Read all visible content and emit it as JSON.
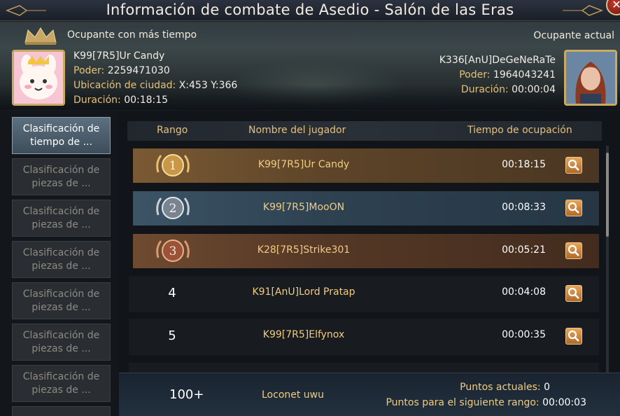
{
  "window": {
    "title": "Información de combate de Asedio - Salón de las Eras",
    "close_icon": "close-icon"
  },
  "header": {
    "longest_label": "Ocupante con más tiempo",
    "current_label": "Ocupante actual",
    "longest": {
      "name": "K99[7R5]Ur Candy",
      "power_label": "Poder:",
      "power": "2259471030",
      "location_label": "Ubicación de ciudad:",
      "location": "X:453 Y:366",
      "duration_label": "Duración:",
      "duration": "00:18:15"
    },
    "current": {
      "name": "K336[AnU]DeGeNeRaTe",
      "power_label": "Poder:",
      "power": "1964043241",
      "duration_label": "Duración:",
      "duration": "00:00:04"
    }
  },
  "sidebar": {
    "items": [
      {
        "label": "Clasificación de tiempo de ...",
        "active": true
      },
      {
        "label": "Clasificación de piezas de ...",
        "active": false
      },
      {
        "label": "Clasificación de piezas de ...",
        "active": false
      },
      {
        "label": "Clasificación de piezas de ...",
        "active": false
      },
      {
        "label": "Clasificación de piezas de ...",
        "active": false
      },
      {
        "label": "Clasificación de piezas de ...",
        "active": false
      },
      {
        "label": "Clasificación de piezas de ...",
        "active": false
      }
    ]
  },
  "table": {
    "headers": {
      "rank": "Rango",
      "player": "Nombre del jugador",
      "time": "Tiempo de ocupación"
    },
    "rows": [
      {
        "rank": "1",
        "name": "K99[7R5]Ur Candy",
        "time": "00:18:15",
        "medal": "gold"
      },
      {
        "rank": "2",
        "name": "K99[7R5]MooON",
        "time": "00:08:33",
        "medal": "silver"
      },
      {
        "rank": "3",
        "name": "K28[7R5]Strike301",
        "time": "00:05:21",
        "medal": "bronze"
      },
      {
        "rank": "4",
        "name": "K91[AnU]Lord Pratap",
        "time": "00:04:08",
        "medal": ""
      },
      {
        "rank": "5",
        "name": "K99[7R5]Elfynox",
        "time": "00:00:35",
        "medal": ""
      }
    ]
  },
  "footer": {
    "rank": "100+",
    "name": "Loconet uwu",
    "points_label": "Puntos actuales:",
    "points": "0",
    "next_label": "Puntos para el siguiente rango:",
    "next": "00:00:03"
  },
  "colors": {
    "accent_gold": "#e6c07a",
    "active_tab": "#5c7080",
    "row_gold": "#7a5a34",
    "row_silver": "#3c5466",
    "row_bronze": "#6e4a30"
  }
}
